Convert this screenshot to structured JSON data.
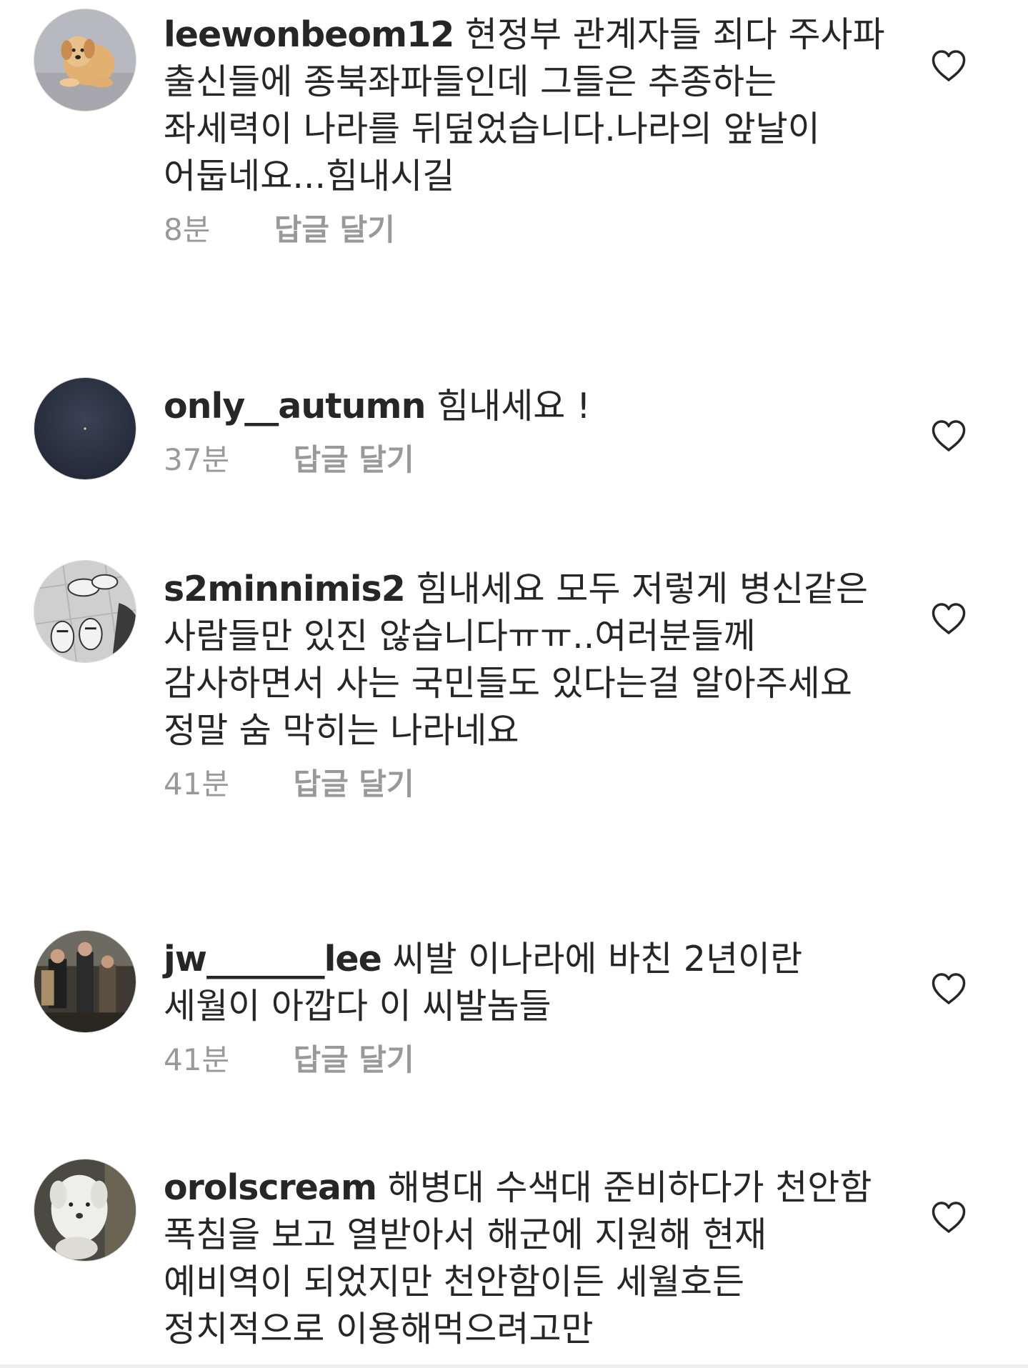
{
  "comments": [
    {
      "username": "leewonbeom12",
      "text": "현정부 관계자들 죄다 주사파 출신들에 종북좌파들인데 그들은 추종하는 좌세력이 나라를 뒤덮었습니다.나라의 앞날이 어둡네요...힘내시길",
      "time": "8분",
      "reply": "답글 달기",
      "avatar_icon": "dog-avatar-icon"
    },
    {
      "username": "only__autumn",
      "text": "힘내세요 !",
      "time": "37분",
      "reply": "답글 달기",
      "avatar_icon": "night-sky-avatar-icon"
    },
    {
      "username": "s2minnimis2",
      "text": "힘내세요 모두 저렇게 병신같은 사람들만 있진 않습니다ㅠㅠ..여러분들께 감사하면서 사는 국민들도 있다는걸 알아주세요 정말 숨 막히는 나라네요",
      "time": "41분",
      "reply": "답글 달기",
      "avatar_icon": "sneakers-avatar-icon"
    },
    {
      "username": "jw_______lee",
      "text": "씨발 이나라에 바친 2년이란 세월이 아깝다 이 씨발놈들",
      "time": "41분",
      "reply": "답글 달기",
      "avatar_icon": "people-avatar-icon"
    },
    {
      "username": "orolscream",
      "text": "해병대 수색대 준비하다가 천안함 폭침을 보고 열받아서 해군에 지원해 현재 예비역이 되었지만 천안함이든 세월호든 정치적으로 이용해먹으려고만",
      "time": "",
      "reply": "",
      "avatar_icon": "white-dog-avatar-icon"
    }
  ],
  "colors": {
    "text": "#262626",
    "meta": "#999999",
    "heart_outline": "#262626"
  },
  "icons": {
    "like": "heart-outline-icon"
  }
}
